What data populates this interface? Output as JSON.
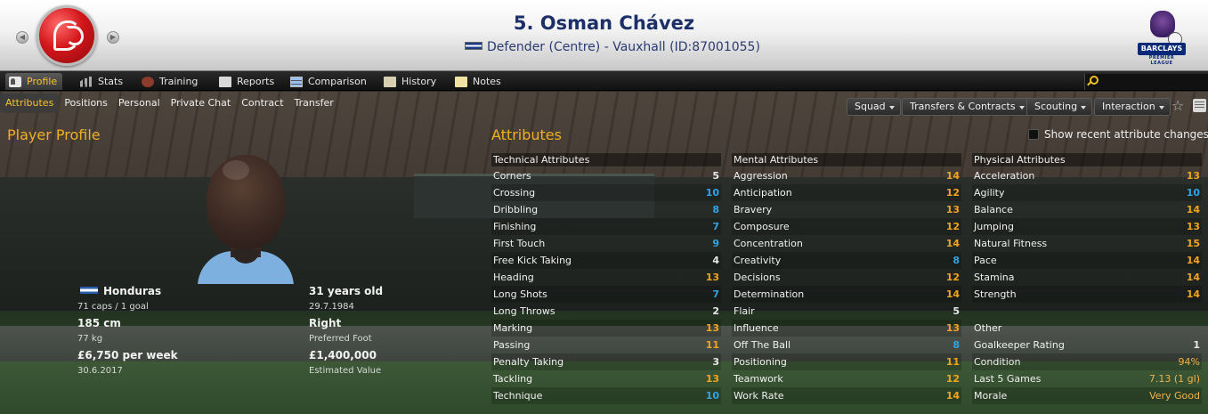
{
  "header": {
    "title": "5. Osman Chávez",
    "subtitle": "Defender (Centre) - Vauxhall (ID:87001055)",
    "league_sponsor": "BARCLAYS",
    "league_sub": "PREMIER LEAGUE"
  },
  "main_tabs": [
    {
      "label": "Profile",
      "icon": "profile-icon"
    },
    {
      "label": "Stats",
      "icon": "stats-icon"
    },
    {
      "label": "Training",
      "icon": "training-icon"
    },
    {
      "label": "Reports",
      "icon": "reports-icon"
    },
    {
      "label": "Comparison",
      "icon": "comparison-icon"
    },
    {
      "label": "History",
      "icon": "history-icon"
    },
    {
      "label": "Notes",
      "icon": "notes-icon"
    }
  ],
  "sub_tabs": [
    "Attributes",
    "Positions",
    "Personal",
    "Private Chat",
    "Contract",
    "Transfer"
  ],
  "actions": {
    "squad": "Squad",
    "transfers": "Transfers & Contracts",
    "scouting": "Scouting",
    "interaction": "Interaction"
  },
  "profile": {
    "heading": "Player Profile",
    "nationality": "Honduras",
    "caps": "71 caps / 1 goal",
    "height": "185 cm",
    "weight": "77 kg",
    "wage": "£6,750 per week",
    "contract_end": "30.6.2017",
    "age": "31 years old",
    "dob": "29.7.1984",
    "foot": "Right",
    "foot_label": "Preferred Foot",
    "value": "£1,400,000",
    "value_label": "Estimated Value"
  },
  "attributes": {
    "heading": "Attributes",
    "show_recent": "Show recent attribute changes",
    "technical": {
      "title": "Technical Attributes",
      "rows": [
        {
          "name": "Corners",
          "value": "5"
        },
        {
          "name": "Crossing",
          "value": "10"
        },
        {
          "name": "Dribbling",
          "value": "8"
        },
        {
          "name": "Finishing",
          "value": "7"
        },
        {
          "name": "First Touch",
          "value": "9"
        },
        {
          "name": "Free Kick Taking",
          "value": "4"
        },
        {
          "name": "Heading",
          "value": "13"
        },
        {
          "name": "Long Shots",
          "value": "7"
        },
        {
          "name": "Long Throws",
          "value": "2"
        },
        {
          "name": "Marking",
          "value": "13"
        },
        {
          "name": "Passing",
          "value": "11"
        },
        {
          "name": "Penalty Taking",
          "value": "3"
        },
        {
          "name": "Tackling",
          "value": "13"
        },
        {
          "name": "Technique",
          "value": "10"
        }
      ]
    },
    "mental": {
      "title": "Mental Attributes",
      "rows": [
        {
          "name": "Aggression",
          "value": "14"
        },
        {
          "name": "Anticipation",
          "value": "12"
        },
        {
          "name": "Bravery",
          "value": "13"
        },
        {
          "name": "Composure",
          "value": "12"
        },
        {
          "name": "Concentration",
          "value": "14"
        },
        {
          "name": "Creativity",
          "value": "8"
        },
        {
          "name": "Decisions",
          "value": "12"
        },
        {
          "name": "Determination",
          "value": "14"
        },
        {
          "name": "Flair",
          "value": "5"
        },
        {
          "name": "Influence",
          "value": "13"
        },
        {
          "name": "Off The Ball",
          "value": "8"
        },
        {
          "name": "Positioning",
          "value": "11"
        },
        {
          "name": "Teamwork",
          "value": "12"
        },
        {
          "name": "Work Rate",
          "value": "14"
        }
      ]
    },
    "physical": {
      "title": "Physical Attributes",
      "rows": [
        {
          "name": "Acceleration",
          "value": "13"
        },
        {
          "name": "Agility",
          "value": "10"
        },
        {
          "name": "Balance",
          "value": "14"
        },
        {
          "name": "Jumping",
          "value": "13"
        },
        {
          "name": "Natural Fitness",
          "value": "15"
        },
        {
          "name": "Pace",
          "value": "14"
        },
        {
          "name": "Stamina",
          "value": "14"
        },
        {
          "name": "Strength",
          "value": "14"
        }
      ]
    },
    "other": {
      "title": "Other",
      "rows": [
        {
          "name": "Goalkeeper Rating",
          "value": "1"
        },
        {
          "name": "Condition",
          "value": "94%"
        },
        {
          "name": "Last 5 Games",
          "value": "7.13 (1 gl)"
        },
        {
          "name": "Morale",
          "value": "Very Good"
        }
      ]
    }
  },
  "colors": {
    "accent": "#f0b020",
    "value_low": "#e8e8e8",
    "value_mid": "#2ea4e6",
    "value_high": "#f3a41c",
    "title_blue": "#1d2f67"
  }
}
